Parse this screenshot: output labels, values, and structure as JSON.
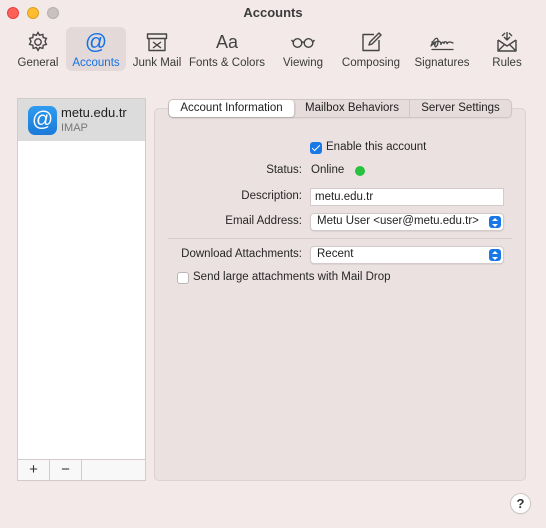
{
  "window": {
    "title": "Accounts"
  },
  "toolbar": {
    "items": [
      {
        "label": "General",
        "icon": "gear-icon"
      },
      {
        "label": "Accounts",
        "icon": "at-icon",
        "active": true
      },
      {
        "label": "Junk Mail",
        "icon": "junk-mail-icon"
      },
      {
        "label": "Fonts & Colors",
        "icon": "fonts-icon",
        "glyph": "Aa"
      },
      {
        "label": "Viewing",
        "icon": "glasses-icon"
      },
      {
        "label": "Composing",
        "icon": "compose-icon"
      },
      {
        "label": "Signatures",
        "icon": "signature-icon"
      },
      {
        "label": "Rules",
        "icon": "rules-icon"
      }
    ]
  },
  "sidebar": {
    "accounts": [
      {
        "name": "metu.edu.tr",
        "type": "IMAP",
        "icon_glyph": "@"
      }
    ],
    "add_glyph": "+",
    "remove_glyph": "−"
  },
  "tabs": [
    {
      "label": "Account Information",
      "active": true
    },
    {
      "label": "Mailbox Behaviors"
    },
    {
      "label": "Server Settings"
    }
  ],
  "form": {
    "enable_label": "Enable this account",
    "enable_checked": true,
    "status_label": "Status:",
    "status_value": "Online",
    "status_color": "#29c240",
    "description_label": "Description:",
    "description_value": "metu.edu.tr",
    "email_label": "Email Address:",
    "email_value": "Metu User <user@metu.edu.tr>",
    "download_label": "Download Attachments:",
    "download_value": "Recent",
    "maildrop_label": "Send large attachments with Mail Drop",
    "maildrop_checked": false
  },
  "help": {
    "glyph": "?"
  },
  "colors": {
    "accent": "#1a78e6",
    "close": "#fe5f57",
    "minimize": "#febc2e",
    "zoom": "#c9c1c1"
  }
}
